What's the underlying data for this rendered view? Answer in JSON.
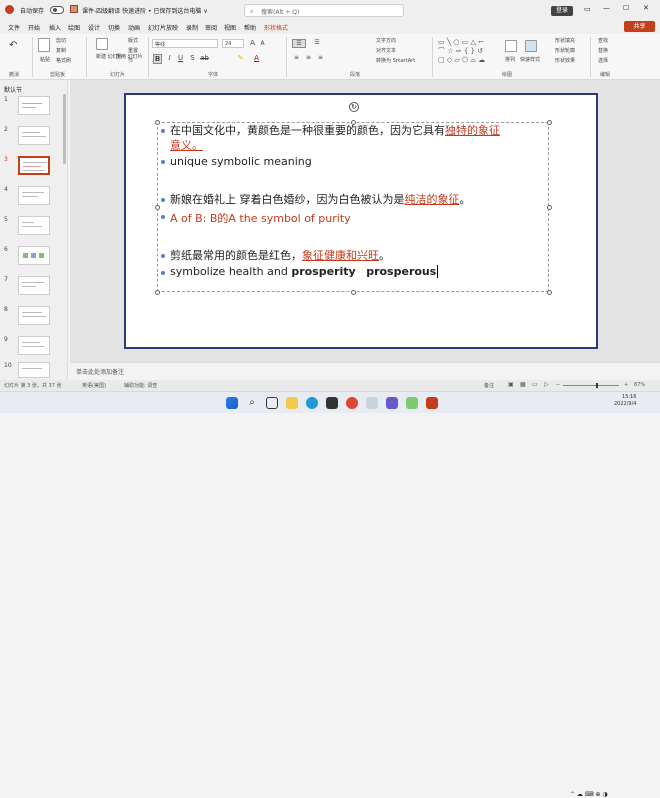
{
  "titlebar": {
    "autosave": "自动保存",
    "toggle": "关",
    "doc_title": "课件-四级翻译 快速进阶 • 已保存到这台电脑 ∨",
    "search_placeholder": "搜索(Alt + Q)",
    "login": "登录"
  },
  "tabs": [
    "文件",
    "开始",
    "插入",
    "绘图",
    "设计",
    "切换",
    "动画",
    "幻灯片放映",
    "录制",
    "审阅",
    "视图",
    "帮助",
    "形状格式"
  ],
  "share": "共享",
  "ribbon": {
    "groups": {
      "undo": "撤消",
      "clipboard": "剪贴板",
      "slides": "幻灯片",
      "font": "字体",
      "paragraph": "段落",
      "drawing": "绘图",
      "editing": "编辑"
    },
    "paste": "粘贴",
    "new_slide": "新建\n幻灯片",
    "reuse": "重用\n幻灯片",
    "layout": "版式",
    "reset": "重置",
    "section": "节",
    "cut": "剪切",
    "copy": "复制",
    "format_painter": "格式刷",
    "font_name": "等线",
    "font_size": "24",
    "text_direction": "文字方向",
    "align_text": "对齐文本",
    "convert_smartart": "转换为 SmartArt",
    "arrange": "排列",
    "quick_styles": "快速样式",
    "shape_fill": "形状填充",
    "shape_outline": "形状轮廓",
    "shape_effects": "形状效果",
    "find": "查找",
    "replace": "替换",
    "select": "选择"
  },
  "thumbs": {
    "section": "默认节",
    "numbers": [
      "1",
      "2",
      "3",
      "4",
      "5",
      "6",
      "7",
      "8",
      "9",
      "10"
    ]
  },
  "slide": {
    "lines": [
      {
        "pre": "在中国文化中，黄颜色是一种很重要的颜色，因为它具有",
        "red": "独特的象征",
        "post": ""
      },
      {
        "pre": "",
        "red": "意义。",
        "post": ""
      },
      {
        "pre": "unique symbolic meaning",
        "red": "",
        "post": ""
      },
      {
        "pre": "新娘在婚礼上 穿着白色婚纱，因为白色被认为是",
        "red": "纯洁的象征",
        "post": "。"
      },
      {
        "pre": "",
        "red": "A of B: B的A  the symbol of purity",
        "post": ""
      },
      {
        "pre": "剪纸最常用的颜色是红色，",
        "red": "象征健康和兴旺",
        "post": "。"
      },
      {
        "pre": "symbolize health and ",
        "bold1": "prosperity",
        "gap": "   ",
        "bold2": "prosperous"
      }
    ]
  },
  "notes": "单击此处添加备注",
  "status": {
    "slide_count": "幻灯片 第 3 张，共 37 张",
    "language": "英语(美国)",
    "accessibility": "辅助功能: 调查",
    "notes_btn": "备注",
    "zoom": "87%"
  },
  "clock": {
    "time": "15:16",
    "date": "2022/9/4"
  },
  "colors": {
    "accent": "#c43e1c",
    "slide_border": "#2f3a7a",
    "red_text": "#c4381c"
  }
}
